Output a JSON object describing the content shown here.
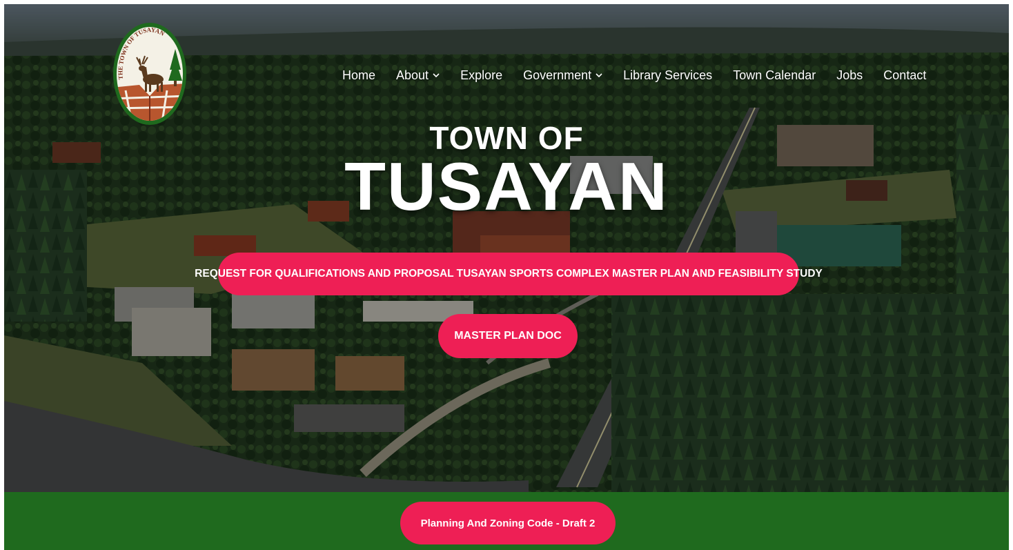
{
  "logo": {
    "arc_text": "THE TOWN OF TUSAYAN",
    "icon": "elk-icon",
    "colors": {
      "ring": "#1f6a1e",
      "canyon": "#b8562e"
    }
  },
  "nav": {
    "items": [
      {
        "label": "Home",
        "has_dropdown": false
      },
      {
        "label": "About",
        "has_dropdown": true
      },
      {
        "label": "Explore",
        "has_dropdown": false
      },
      {
        "label": "Government",
        "has_dropdown": true
      },
      {
        "label": "Library Services",
        "has_dropdown": false
      },
      {
        "label": "Town Calendar",
        "has_dropdown": false
      },
      {
        "label": "Jobs",
        "has_dropdown": false
      },
      {
        "label": "Contact",
        "has_dropdown": false
      }
    ]
  },
  "hero": {
    "title_line1": "TOWN OF",
    "title_line2": "TUSAYAN",
    "rfq_button": "REQUEST FOR QUALIFICATIONS AND PROPOSAL TUSAYAN SPORTS COMPLEX MASTER PLAN AND FEASIBILITY STUDY",
    "master_plan_button": "MASTER PLAN DOC"
  },
  "band": {
    "zoning_button": "Planning And Zoning Code - Draft 2"
  },
  "colors": {
    "accent": "#ee1f55",
    "band_green": "#1f6a1e"
  }
}
